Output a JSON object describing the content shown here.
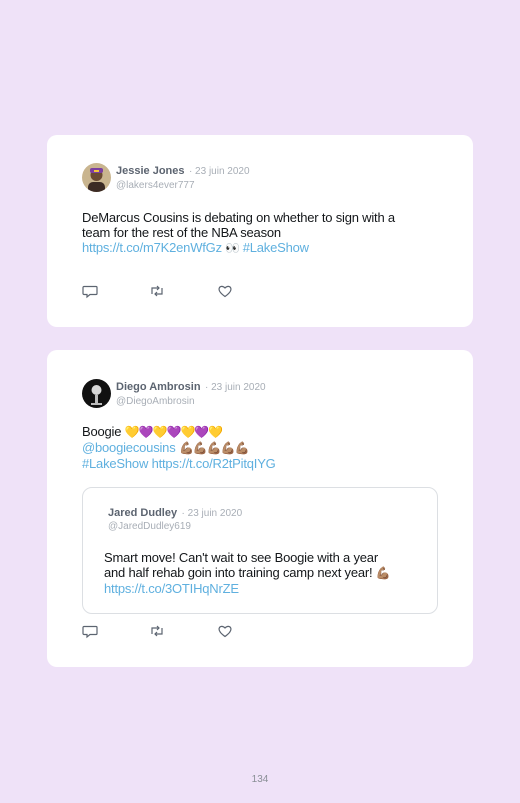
{
  "tweets": [
    {
      "name": "Jessie Jones",
      "date": "· 23 juin 2020",
      "handle": "@lakers4ever777",
      "text_line1": "DeMarcus Cousins is debating on whether to sign with a",
      "text_line2": "team for the rest of the NBA season",
      "link": "https://t.co/m7K2enWfGz",
      "emoji": "👀",
      "hashtag": "#LakeShow"
    },
    {
      "name": "Diego Ambrosin",
      "date": "· 23 juin 2020",
      "handle": "@DiegoAmbrosin",
      "text_word": "Boogie",
      "hearts": "💛💜💛💜💛💜💛",
      "mention": "@boogiecousins",
      "flexes": "💪🏽💪🏽💪🏽💪🏽💪🏽",
      "hashtag": "#LakeShow",
      "link": "https://t.co/R2tPitqIYG",
      "quote": {
        "name": "Jared Dudley",
        "date": "· 23 juin 2020",
        "handle": "@JaredDudley619",
        "text_line1": "Smart move! Can't wait to see Boogie with a year",
        "text_line2": "and half rehab goin into training camp next year!",
        "flex": "💪🏽",
        "link": "https://t.co/3OTIHqNrZE"
      }
    }
  ],
  "icons": [
    "reply-icon",
    "retweet-icon",
    "like-icon"
  ],
  "page_number": "134"
}
